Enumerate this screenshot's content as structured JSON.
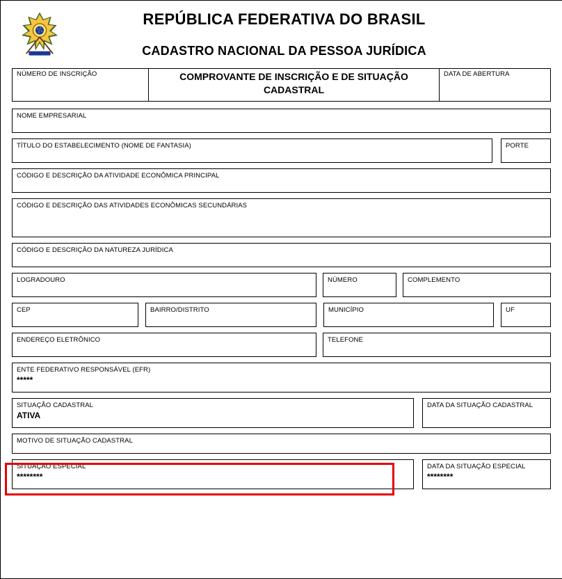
{
  "header": {
    "country": "REPÚBLICA FEDERATIVA DO BRASIL",
    "registry": "CADASTRO NACIONAL DA PESSOA JURÍDICA"
  },
  "topRow": {
    "numeroInscricaoLabel": "NÚMERO DE INSCRIÇÃO",
    "numeroInscricaoValue": "",
    "comprovanteTitle": "COMPROVANTE DE INSCRIÇÃO E DE SITUAÇÃO CADASTRAL",
    "dataAberturaLabel": "DATA DE ABERTURA",
    "dataAberturaValue": ""
  },
  "nomeEmpresarial": {
    "label": "NOME EMPRESARIAL",
    "value": ""
  },
  "tituloEstabelecimento": {
    "label": "TÍTULO DO ESTABELECIMENTO (NOME DE FANTASIA)",
    "value": ""
  },
  "porte": {
    "label": "PORTE",
    "value": ""
  },
  "atividadePrincipal": {
    "label": "CÓDIGO E DESCRIÇÃO DA ATIVIDADE ECONÔMICA PRINCIPAL",
    "value": ""
  },
  "atividadesSecundarias": {
    "label": "CÓDIGO E DESCRIÇÃO DAS ATIVIDADES ECONÔMICAS SECUNDÁRIAS",
    "value": ""
  },
  "naturezaJuridica": {
    "label": "CÓDIGO E DESCRIÇÃO DA NATUREZA JURÍDICA",
    "value": ""
  },
  "logradouro": {
    "label": "LOGRADOURO",
    "value": ""
  },
  "numero": {
    "label": "NÚMERO",
    "value": ""
  },
  "complemento": {
    "label": "COMPLEMENTO",
    "value": ""
  },
  "cep": {
    "label": "CEP",
    "value": ""
  },
  "bairro": {
    "label": "BAIRRO/DISTRITO",
    "value": ""
  },
  "municipio": {
    "label": "MUNICÍPIO",
    "value": ""
  },
  "uf": {
    "label": "UF",
    "value": ""
  },
  "enderecoEletronico": {
    "label": "ENDEREÇO ELETRÔNICO",
    "value": ""
  },
  "telefone": {
    "label": "TELEFONE",
    "value": ""
  },
  "efr": {
    "label": "ENTE FEDERATIVO RESPONSÁVEL (EFR)",
    "value": "*****"
  },
  "situacaoCadastral": {
    "label": "SITUAÇÃO CADASTRAL",
    "value": "ATIVA"
  },
  "dataSituacaoCadastral": {
    "label": "DATA DA SITUAÇÃO CADASTRAL",
    "value": ""
  },
  "motivoSituacao": {
    "label": "MOTIVO DE SITUAÇÃO CADASTRAL",
    "value": ""
  },
  "situacaoEspecial": {
    "label": "SITUAÇÃO ESPECIAL",
    "value": "********"
  },
  "dataSituacaoEspecial": {
    "label": "DATA DA SITUAÇÃO ESPECIAL",
    "value": "********"
  }
}
